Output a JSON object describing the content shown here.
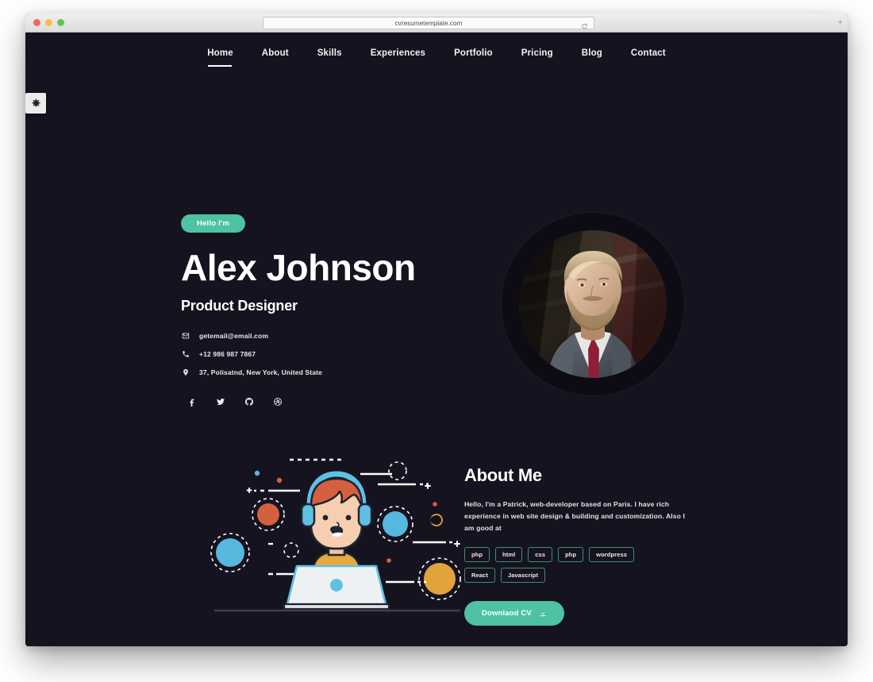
{
  "browser": {
    "url": "cvresumetemplate.com",
    "reload_icon": "reload-icon",
    "new_tab_label": "+",
    "traffic_lights": [
      "close",
      "minimize",
      "zoom"
    ]
  },
  "site": {
    "settings_toggle_icon": "gear-icon",
    "nav": {
      "items": [
        {
          "label": "Home",
          "active": true
        },
        {
          "label": "About",
          "active": false
        },
        {
          "label": "Skills",
          "active": false
        },
        {
          "label": "Experiences",
          "active": false
        },
        {
          "label": "Portfolio",
          "active": false
        },
        {
          "label": "Pricing",
          "active": false
        },
        {
          "label": "Blog",
          "active": false
        },
        {
          "label": "Contact",
          "active": false
        }
      ]
    },
    "hero": {
      "badge": "Hello I'm",
      "name": "Alex Johnson",
      "role": "Product Designer",
      "contacts": [
        {
          "icon": "envelope-icon",
          "text": "getemail@email.com"
        },
        {
          "icon": "phone-icon",
          "text": "+12 986 987 7867"
        },
        {
          "icon": "location-pin-icon",
          "text": "37, Polisatnd, New York, United State"
        }
      ],
      "socials": [
        {
          "icon": "facebook-icon",
          "name": "Facebook"
        },
        {
          "icon": "twitter-icon",
          "name": "Twitter"
        },
        {
          "icon": "github-icon",
          "name": "GitHub"
        },
        {
          "icon": "dribbble-icon",
          "name": "Dribbble"
        }
      ],
      "portrait_alt": "bearded-man-portrait"
    },
    "about": {
      "illustration_alt": "developer-with-headphones-at-laptop-illustration",
      "title": "About Me",
      "paragraph": "Hello, I'm a Patrick, web-developer based on Paris. I have rich experience in web site design & building and customization. Also I am good at",
      "tags": [
        "php",
        "html",
        "css",
        "php",
        "wordpress",
        "React",
        "Javascript"
      ],
      "download_label": "Downlaod CV",
      "download_icon": "download-icon"
    }
  },
  "colors": {
    "background": "#15131f",
    "accent": "#4ec2a3",
    "tag_border": "#3f8d78",
    "text": "#ffffff"
  }
}
